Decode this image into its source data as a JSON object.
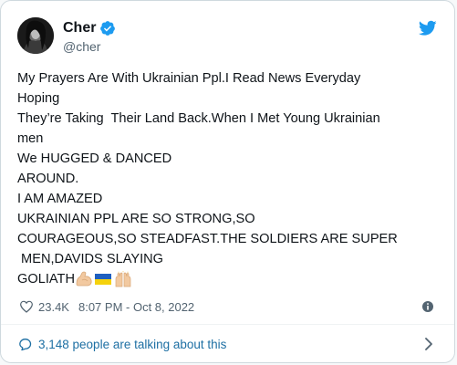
{
  "author": {
    "display_name": "Cher",
    "handle": "@cher"
  },
  "tweet": {
    "lines": [
      "My Prayers Are With Ukrainian Ppl.I Read News Everyday",
      "Hoping",
      "They’re Taking  Their Land Back.When I Met Young Ukrainian",
      "men",
      "We HUGGED & DANCED",
      "AROUND.",
      "I AM AMAZED",
      "UKRAINIAN PPL ARE SO STRONG,SO",
      "COURAGEOUS,SO STEADFAST.THE SOLDIERS ARE SUPER",
      " MEN,DAVIDS SLAYING",
      "GOLIATH"
    ],
    "emoji": [
      "flexed-biceps",
      "ukraine-flag",
      "raising-hands"
    ]
  },
  "meta": {
    "likes": "23.4K",
    "timestamp": "8:07 PM - Oct 8, 2022"
  },
  "footer": {
    "talking": "3,148 people are talking about this"
  },
  "colors": {
    "twitter_blue": "#1d9bf0",
    "link_blue": "#1d6fa3",
    "text": "#0f1419",
    "secondary": "#536471"
  },
  "icons": [
    "verified-badge-icon",
    "twitter-bird-icon",
    "heart-icon",
    "info-icon",
    "speech-bubble-icon",
    "chevron-right-icon"
  ]
}
